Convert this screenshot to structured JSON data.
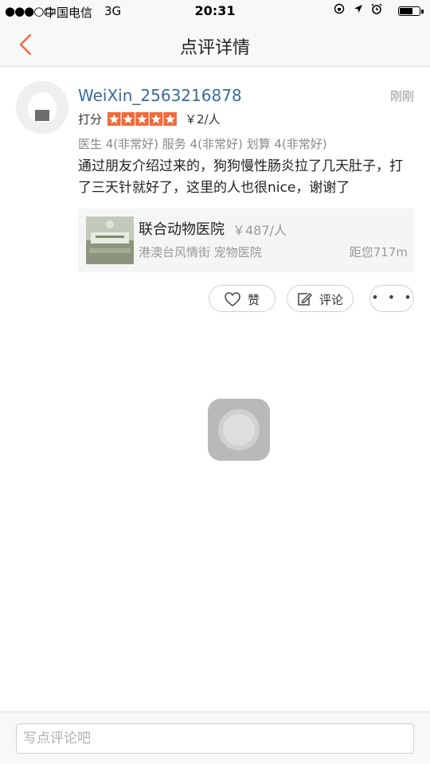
{
  "status_bar": {
    "signal": "●●●○○",
    "carrier": "中国电信",
    "network": "3G",
    "time": "20:31",
    "battery_level": 0.65
  },
  "nav": {
    "title": "点评详情"
  },
  "review": {
    "username": "WeiXin_2563216878",
    "time_ago": "刚刚",
    "rating_label": "打分",
    "stars": 5,
    "price": "￥2/人",
    "sub_scores": "医生 4(非常好) 服务 4(非常好) 划算 4(非常好)",
    "text": "通过朋友介绍过来的，狗狗慢性肠炎拉了几天肚子，打了三天针就好了，这里的人也很nice，谢谢了"
  },
  "business": {
    "name": "联合动物医院",
    "price": "￥487/人",
    "location": "港澳台风情街 宠物医院",
    "distance": "距您717m"
  },
  "actions": {
    "like_label": "赞",
    "comment_label": "评论",
    "more_label": "• • •"
  },
  "comment_box": {
    "placeholder": "写点评论吧"
  },
  "colors": {
    "accent": "#f06a3c",
    "username": "#3a6b9a",
    "muted": "#999999"
  }
}
